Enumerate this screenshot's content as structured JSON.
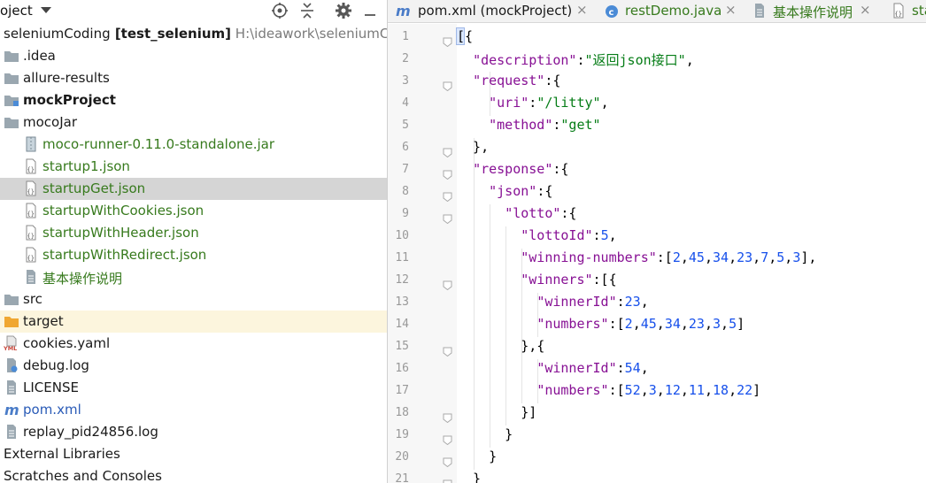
{
  "project": {
    "title": "oject",
    "buttons": {
      "locate": "locate-icon",
      "collapse": "collapse-all-icon",
      "settings": "gear-icon",
      "hide": "minimize-icon"
    },
    "rows": [
      {
        "label": "seleniumCoding",
        "extra": " [test_selenium]",
        "path": "  H:\\ideawork\\seleniumCod",
        "indent": 0,
        "icon": "none",
        "style": "normal"
      },
      {
        "label": ".idea",
        "indent": 0,
        "icon": "folder",
        "style": "normal"
      },
      {
        "label": "allure-results",
        "indent": 0,
        "icon": "folder",
        "style": "normal"
      },
      {
        "label": "mockProject",
        "indent": 0,
        "icon": "module-folder",
        "style": "bold"
      },
      {
        "label": "mocoJar",
        "indent": 0,
        "icon": "folder",
        "style": "normal"
      },
      {
        "label": "moco-runner-0.11.0-standalone.jar",
        "indent": 1,
        "icon": "jar-file",
        "style": "green"
      },
      {
        "label": "startup1.json",
        "indent": 1,
        "icon": "json-file",
        "style": "green"
      },
      {
        "label": "startupGet.json",
        "indent": 1,
        "icon": "json-file",
        "style": "green",
        "selected": true
      },
      {
        "label": "startupWithCookies.json",
        "indent": 1,
        "icon": "json-file",
        "style": "green"
      },
      {
        "label": "startupWithHeader.json",
        "indent": 1,
        "icon": "json-file",
        "style": "green"
      },
      {
        "label": "startupWithRedirect.json",
        "indent": 1,
        "icon": "json-file",
        "style": "green"
      },
      {
        "label": "基本操作说明",
        "indent": 1,
        "icon": "text-file",
        "style": "green"
      },
      {
        "label": "src",
        "indent": 0,
        "icon": "folder",
        "style": "normal"
      },
      {
        "label": "target",
        "indent": 0,
        "icon": "excluded-folder",
        "style": "normal",
        "highlight": true
      },
      {
        "label": "cookies.yaml",
        "indent": 0,
        "icon": "yaml-file",
        "style": "normal"
      },
      {
        "label": "debug.log",
        "indent": 0,
        "icon": "log-file",
        "style": "normal"
      },
      {
        "label": "LICENSE",
        "indent": 0,
        "icon": "text-file",
        "style": "normal"
      },
      {
        "label": "pom.xml",
        "indent": 0,
        "icon": "maven-file",
        "style": "blue"
      },
      {
        "label": "replay_pid24856.log",
        "indent": 0,
        "icon": "text-file",
        "style": "normal"
      },
      {
        "label": "External Libraries",
        "indent": 0,
        "icon": "none",
        "style": "normal"
      },
      {
        "label": "Scratches and Consoles",
        "indent": 0,
        "icon": "none",
        "style": "normal"
      }
    ]
  },
  "editor": {
    "tabs": [
      {
        "label": "pom.xml (mockProject)",
        "icon": "maven-file",
        "style": "normal"
      },
      {
        "label": "restDemo.java",
        "icon": "java-class-file",
        "style": "green"
      },
      {
        "label": "基本操作说明",
        "icon": "text-file",
        "style": "green"
      },
      {
        "label": "sta",
        "icon": "json-file",
        "style": "green"
      }
    ],
    "close_glyph": "×",
    "line_numbers": [
      "1",
      "2",
      "3",
      "4",
      "5",
      "6",
      "7",
      "8",
      "9",
      "10",
      "11",
      "12",
      "13",
      "14",
      "15",
      "16",
      "17",
      "18",
      "19",
      "20",
      "21"
    ],
    "lines": [
      [
        [
          "p",
          "[{"
        ]
      ],
      [
        [
          "p",
          "  "
        ],
        [
          "k",
          "\"description\""
        ],
        [
          "p",
          ":"
        ],
        [
          "s",
          "\"返回json接口\""
        ],
        [
          "p",
          ","
        ]
      ],
      [
        [
          "p",
          "  "
        ],
        [
          "k",
          "\"request\""
        ],
        [
          "p",
          ":{"
        ]
      ],
      [
        [
          "p",
          "    "
        ],
        [
          "k",
          "\"uri\""
        ],
        [
          "p",
          ":"
        ],
        [
          "s",
          "\"/litty\""
        ],
        [
          "p",
          ","
        ]
      ],
      [
        [
          "p",
          "    "
        ],
        [
          "k",
          "\"method\""
        ],
        [
          "p",
          ":"
        ],
        [
          "s",
          "\"get\""
        ]
      ],
      [
        [
          "p",
          "  },"
        ]
      ],
      [
        [
          "p",
          "  "
        ],
        [
          "k",
          "\"response\""
        ],
        [
          "p",
          ":{"
        ]
      ],
      [
        [
          "p",
          "    "
        ],
        [
          "k",
          "\"json\""
        ],
        [
          "p",
          ":{"
        ]
      ],
      [
        [
          "p",
          "      "
        ],
        [
          "k",
          "\"lotto\""
        ],
        [
          "p",
          ":{"
        ]
      ],
      [
        [
          "p",
          "        "
        ],
        [
          "k",
          "\"lottoId\""
        ],
        [
          "p",
          ":"
        ],
        [
          "n",
          "5"
        ],
        [
          "p",
          ","
        ]
      ],
      [
        [
          "p",
          "        "
        ],
        [
          "k",
          "\"winning-numbers\""
        ],
        [
          "p",
          ":["
        ],
        [
          "n",
          "2"
        ],
        [
          "p",
          ","
        ],
        [
          "n",
          "45"
        ],
        [
          "p",
          ","
        ],
        [
          "n",
          "34"
        ],
        [
          "p",
          ","
        ],
        [
          "n",
          "23"
        ],
        [
          "p",
          ","
        ],
        [
          "n",
          "7"
        ],
        [
          "p",
          ","
        ],
        [
          "n",
          "5"
        ],
        [
          "p",
          ","
        ],
        [
          "n",
          "3"
        ],
        [
          "p",
          "],"
        ]
      ],
      [
        [
          "p",
          "        "
        ],
        [
          "k",
          "\"winners\""
        ],
        [
          "p",
          ":[{"
        ]
      ],
      [
        [
          "p",
          "          "
        ],
        [
          "k",
          "\"winnerId\""
        ],
        [
          "p",
          ":"
        ],
        [
          "n",
          "23"
        ],
        [
          "p",
          ","
        ]
      ],
      [
        [
          "p",
          "          "
        ],
        [
          "k",
          "\"numbers\""
        ],
        [
          "p",
          ":["
        ],
        [
          "n",
          "2"
        ],
        [
          "p",
          ","
        ],
        [
          "n",
          "45"
        ],
        [
          "p",
          ","
        ],
        [
          "n",
          "34"
        ],
        [
          "p",
          ","
        ],
        [
          "n",
          "23"
        ],
        [
          "p",
          ","
        ],
        [
          "n",
          "3"
        ],
        [
          "p",
          ","
        ],
        [
          "n",
          "5"
        ],
        [
          "p",
          "]"
        ]
      ],
      [
        [
          "p",
          "        },{"
        ]
      ],
      [
        [
          "p",
          "          "
        ],
        [
          "k",
          "\"winnerId\""
        ],
        [
          "p",
          ":"
        ],
        [
          "n",
          "54"
        ],
        [
          "p",
          ","
        ]
      ],
      [
        [
          "p",
          "          "
        ],
        [
          "k",
          "\"numbers\""
        ],
        [
          "p",
          ":["
        ],
        [
          "n",
          "52"
        ],
        [
          "p",
          ","
        ],
        [
          "n",
          "3"
        ],
        [
          "p",
          ","
        ],
        [
          "n",
          "12"
        ],
        [
          "p",
          ","
        ],
        [
          "n",
          "11"
        ],
        [
          "p",
          ","
        ],
        [
          "n",
          "18"
        ],
        [
          "p",
          ","
        ],
        [
          "n",
          "22"
        ],
        [
          "p",
          "]"
        ]
      ],
      [
        [
          "p",
          "        }]"
        ]
      ],
      [
        [
          "p",
          "      }"
        ]
      ],
      [
        [
          "p",
          "    }"
        ]
      ],
      [
        [
          "p",
          "  }"
        ]
      ]
    ],
    "fold_markers": [
      "1",
      "3",
      "6",
      "7",
      "8",
      "9",
      "12",
      "15",
      "18",
      "19",
      "20",
      "21"
    ],
    "colors": {
      "key": "#871094",
      "string": "#067d17",
      "number": "#1750eb",
      "selection": "#d5d5d5",
      "excluded": "#fcf5dd"
    }
  }
}
